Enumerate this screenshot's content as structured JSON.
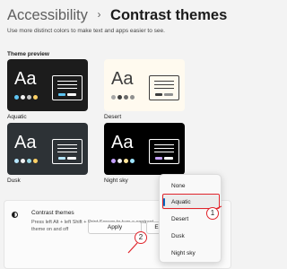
{
  "breadcrumb": {
    "parent": "Accessibility",
    "separator": "›",
    "current": "Contrast themes"
  },
  "subtitle": "Use more distinct colors to make text and apps easier to see.",
  "theme_preview": {
    "label": "Theme preview",
    "themes": [
      {
        "name": "Aquatic",
        "sample": "Aa",
        "bg": "#1c1c1c",
        "fg": "#ffffff",
        "dots": [
          "#5ec4f2",
          "#f0f0f0",
          "#c7c7c7",
          "#ffd166"
        ]
      },
      {
        "name": "Desert",
        "sample": "Aa",
        "bg": "#fffaef",
        "fg": "#3d3d3d",
        "dots": [
          "#a6a6a6",
          "#3d3d3d",
          "#6b6b6b",
          "#8f8f8f"
        ]
      },
      {
        "name": "Dusk",
        "sample": "Aa",
        "bg": "#2d3236",
        "fg": "#ffffff",
        "dots": [
          "#b7e7ff",
          "#f3f3f3",
          "#9adbe8",
          "#ffd166"
        ]
      },
      {
        "name": "Night sky",
        "sample": "Aa",
        "bg": "#000000",
        "fg": "#ffffff",
        "dots": [
          "#c5a1ff",
          "#f0f0f0",
          "#ffe599",
          "#9ee5ff"
        ]
      }
    ]
  },
  "contrast_setting": {
    "title": "Contrast themes",
    "description": "Press left Alt + left Shift + Print Screen to turn a contrast theme on and off",
    "apply_label": "Apply",
    "edit_label": "Edit"
  },
  "dropdown": {
    "options": [
      "None",
      "Aquatic",
      "Desert",
      "Dusk",
      "Night sky"
    ],
    "selected": "Aquatic"
  },
  "annotations": {
    "callout_1": "1",
    "callout_2": "2",
    "color": "#e0242b"
  }
}
